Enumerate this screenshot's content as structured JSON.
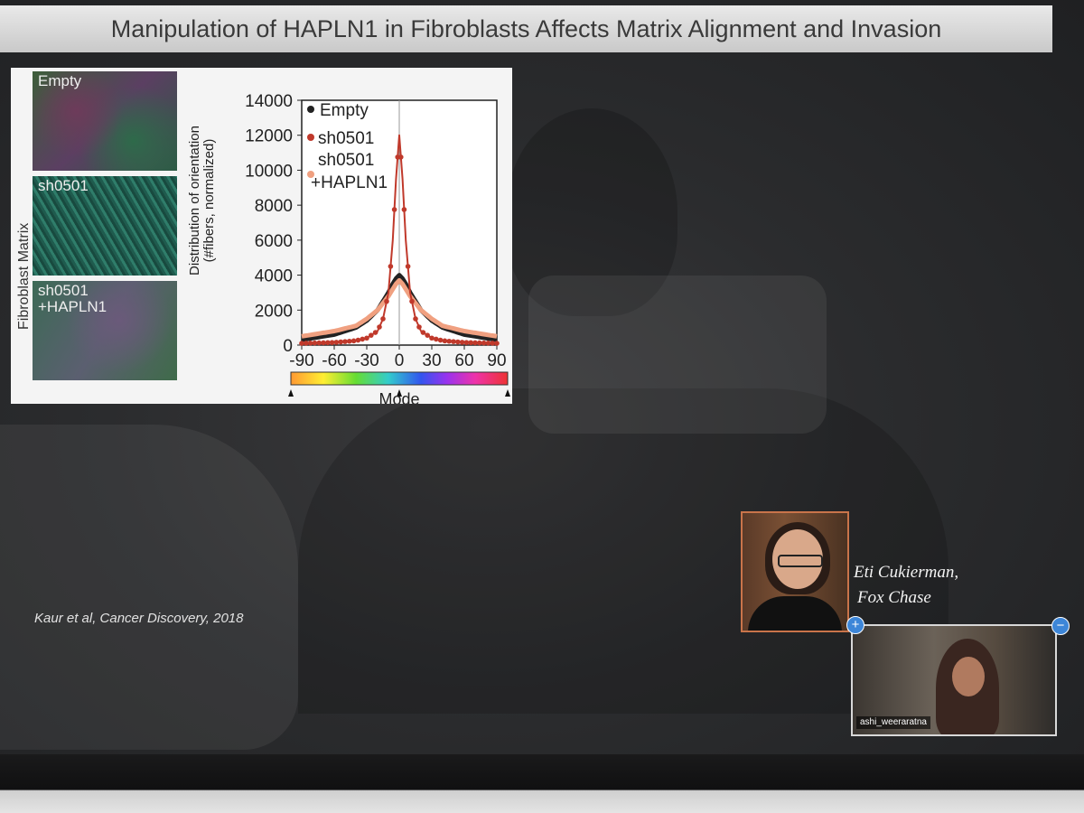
{
  "slide": {
    "title": "Manipulation of HAPLN1 in Fibroblasts Affects Matrix Alignment and Invasion",
    "citation": "Kaur et al, Cancer Discovery, 2018"
  },
  "figure": {
    "side_label": "Fibroblast Matrix",
    "micrograph_labels": [
      "Empty",
      "sh0501",
      "sh0501\n+HAPLN1"
    ],
    "ylabel": "Distribution of orientation (#fibers, normalized)",
    "colorbar_label": "Mode"
  },
  "chart_data": {
    "type": "line",
    "x_ticks": [
      "-90",
      "-60",
      "-30",
      "0",
      "30",
      "60",
      "90"
    ],
    "y_ticks": [
      "0",
      "2000",
      "4000",
      "6000",
      "8000",
      "10000",
      "12000",
      "14000"
    ],
    "xlim": [
      -90,
      90
    ],
    "ylim": [
      0,
      14000
    ],
    "xlabel": "Mode",
    "ylabel": "Distribution of orientation (#fibers, normalized)",
    "legend": "top-left",
    "x": [
      -90,
      -60,
      -40,
      -30,
      -20,
      -15,
      -10,
      -6,
      -3,
      0,
      3,
      6,
      10,
      15,
      20,
      30,
      40,
      60,
      90
    ],
    "series": [
      {
        "name": "Empty",
        "color": "#222222",
        "values": [
          300,
          600,
          1000,
          1400,
          2000,
          2500,
          3000,
          3500,
          3800,
          4000,
          3800,
          3500,
          3000,
          2500,
          2000,
          1400,
          1000,
          600,
          300
        ]
      },
      {
        "name": "sh0501",
        "color": "#c0392b",
        "values": [
          100,
          150,
          250,
          400,
          800,
          1500,
          3000,
          6000,
          9500,
          12000,
          9500,
          6000,
          3000,
          1500,
          800,
          400,
          250,
          150,
          100
        ]
      },
      {
        "name": "sh0501 +HAPLN1",
        "color": "#f0a080",
        "values": [
          500,
          800,
          1100,
          1500,
          2000,
          2400,
          2800,
          3200,
          3500,
          3700,
          3500,
          3200,
          2800,
          2400,
          2000,
          1500,
          1100,
          800,
          500
        ]
      }
    ]
  },
  "video": {
    "speaker_name_line1": "Eti Cukierman,",
    "speaker_name_line2": "Fox Chase",
    "participant_name": "ashi_weeraratna",
    "zoom_in_label": "+",
    "zoom_out_label": "−"
  }
}
